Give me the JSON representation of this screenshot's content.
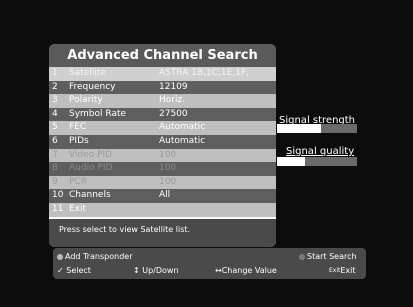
{
  "menu": {
    "title": "Advanced Channel Search",
    "rows": [
      {
        "num": "1",
        "label": "Satellite",
        "value": "ASTRA 1B,1C,1E,1F,"
      },
      {
        "num": "2",
        "label": "Frequency",
        "value": "12109"
      },
      {
        "num": "3",
        "label": "Polarity",
        "value": "Horiz."
      },
      {
        "num": "4",
        "label": "Symbol Rate",
        "value": "27500"
      },
      {
        "num": "5",
        "label": "FEC",
        "value": "Automatic"
      },
      {
        "num": "6",
        "label": "PIDs",
        "value": "Automatic"
      },
      {
        "num": "7",
        "label": "Video PID",
        "value": "100"
      },
      {
        "num": "8",
        "label": "Audio PID",
        "value": "100"
      },
      {
        "num": "9",
        "label": "PCR",
        "value": "100"
      },
      {
        "num": "10",
        "label": "Channels",
        "value": "All"
      },
      {
        "num": "11",
        "label": "Exit",
        "value": ""
      }
    ],
    "hint": "Press select to view Satellite list."
  },
  "signal": {
    "strength_label": "Signal strength",
    "strength_level": 0.55,
    "quality_label": "Signal quality",
    "quality_level": 0.35
  },
  "footer": {
    "add_transponder": "Add Transponder",
    "start_search": "Start Search",
    "select": "Select",
    "updown": "Up/Down",
    "change_value": "Change Value",
    "exit": "Exit",
    "select_icon": "check-icon",
    "updown_icon": "updown-arrow-icon",
    "leftright_icon": "left-right-arrow-icon",
    "exit_icon": "exit-key-icon",
    "exit_icon_glyph": "Exit"
  }
}
